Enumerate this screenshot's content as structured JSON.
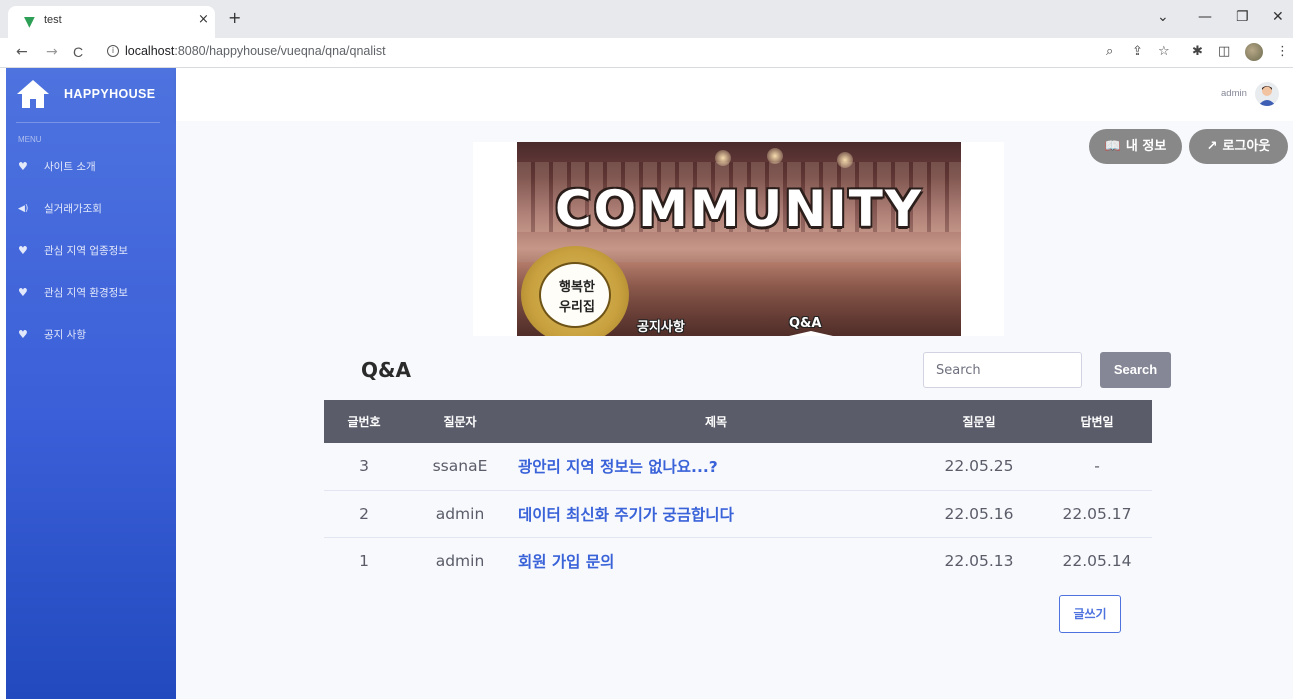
{
  "browser": {
    "tab_title": "test",
    "tab_close": "×",
    "new_tab": "+",
    "window_controls": [
      "⌄",
      "—",
      "❐",
      "✕"
    ],
    "nav": {
      "back": "←",
      "forward": "→",
      "reload": "C"
    },
    "url_host": "localhost",
    "url_path": ":8080/happyhouse/vueqna/qna/qnalist",
    "toolbar_icons": [
      "zoom-icon",
      "share-icon",
      "star-icon",
      "extensions-icon",
      "sidepanel-icon",
      "profile-icon",
      "menu-icon"
    ]
  },
  "sidebar": {
    "brand": "HAPPYHOUSE",
    "menu_heading": "MENU",
    "items": [
      {
        "label": "사이트 소개",
        "icon": "heart-icon"
      },
      {
        "label": "실거래가조회",
        "icon": "volume-icon"
      },
      {
        "label": "관심 지역 업종정보",
        "icon": "heart-icon"
      },
      {
        "label": "관심 지역 환경정보",
        "icon": "heart-icon"
      },
      {
        "label": "공지 사항",
        "icon": "heart-icon"
      }
    ]
  },
  "topbar": {
    "user_name": "admin"
  },
  "actions": {
    "my_info": "내 정보",
    "logout": "로그아웃"
  },
  "banner": {
    "title": "COMMUNITY",
    "badge_line1": "행복한",
    "badge_line2": "우리집",
    "nav_notice": "공지사항",
    "nav_qna": "Q&A"
  },
  "page": {
    "heading": "Q&A",
    "search_placeholder": "Search",
    "search_button": "Search",
    "write_button": "글쓰기"
  },
  "table": {
    "headers": [
      "글번호",
      "질문자",
      "제목",
      "질문일",
      "답변일"
    ],
    "rows": [
      {
        "no": "3",
        "author": "ssanaE",
        "title": "광안리 지역 정보는 없나요...?",
        "asked": "22.05.25",
        "answered": "-"
      },
      {
        "no": "2",
        "author": "admin",
        "title": "데이터 최신화 주기가 궁금합니다",
        "asked": "22.05.16",
        "answered": "22.05.17"
      },
      {
        "no": "1",
        "author": "admin",
        "title": "회원 가입 문의",
        "asked": "22.05.13",
        "answered": "22.05.14"
      }
    ]
  },
  "colors": {
    "sidebar_top": "#4e73df",
    "sidebar_bottom": "#224abe",
    "table_header": "#5a5c69",
    "link": "#3a63d9",
    "pill_button": "#888888"
  }
}
